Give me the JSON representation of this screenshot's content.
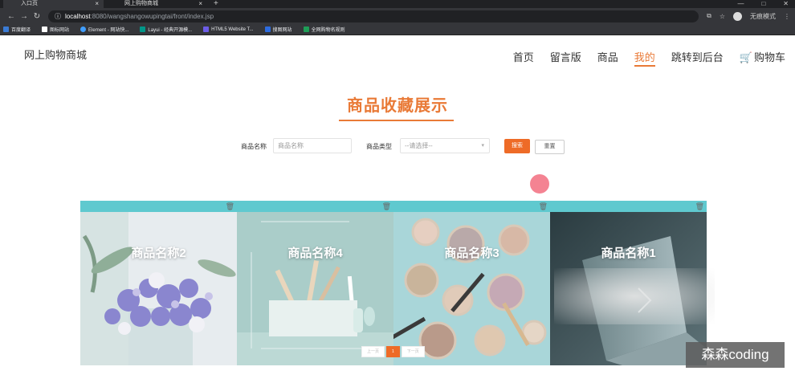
{
  "browser": {
    "tabs": [
      {
        "title": "入口页",
        "active": true
      },
      {
        "title": "网上购物商城",
        "active": false
      }
    ],
    "new_tab": "+",
    "window_controls": [
      "—",
      "□",
      "✕"
    ],
    "url_host": "localhost",
    "url_path": ":8080/wangshangowupingtai/front/index.jsp",
    "profile_label": "无痕模式",
    "bookmarks": [
      {
        "label": "百度翻译",
        "color": "#3a7bd5"
      },
      {
        "label": "图标网站",
        "color": "#ffffff"
      },
      {
        "label": "Element - 网站快...",
        "color": "#409eff"
      },
      {
        "label": "Layui - 经典开源模...",
        "color": "#009688"
      },
      {
        "label": "HTML5 Website T...",
        "color": "#6c5ce7"
      },
      {
        "label": "搜图网站",
        "color": "#2d6cdf"
      },
      {
        "label": "全网购物名规则",
        "color": "#1e9e57"
      }
    ]
  },
  "site": {
    "logo": "网上购物商城",
    "menu": [
      {
        "label": "首页",
        "active": false
      },
      {
        "label": "留言版",
        "active": false
      },
      {
        "label": "商品",
        "active": false
      },
      {
        "label": "我的",
        "active": true
      },
      {
        "label": "跳转到后台",
        "active": false
      },
      {
        "label": "购物车",
        "active": false
      }
    ],
    "cart_icon": "🛒",
    "page_title": "商品收藏展示",
    "filters": {
      "name_label": "商品名称",
      "name_placeholder": "商品名称",
      "type_label": "商品类型",
      "type_selected": "--请选择--",
      "search_btn": "搜索",
      "reset_btn": "重置"
    },
    "cards": [
      {
        "name": "商品名称2",
        "image": "flowers"
      },
      {
        "name": "商品名称4",
        "image": "brushes-pot"
      },
      {
        "name": "商品名称3",
        "image": "cosmetics"
      },
      {
        "name": "商品名称1",
        "image": "laptop"
      }
    ],
    "delete_icon": "🗑",
    "pager": {
      "prev": "上一页",
      "current": "1",
      "next": "下一页"
    },
    "watermark": "森森coding"
  },
  "colors": {
    "accent": "#e97a37",
    "card_bar": "#5fc9cf",
    "button": "#ee6b27"
  }
}
